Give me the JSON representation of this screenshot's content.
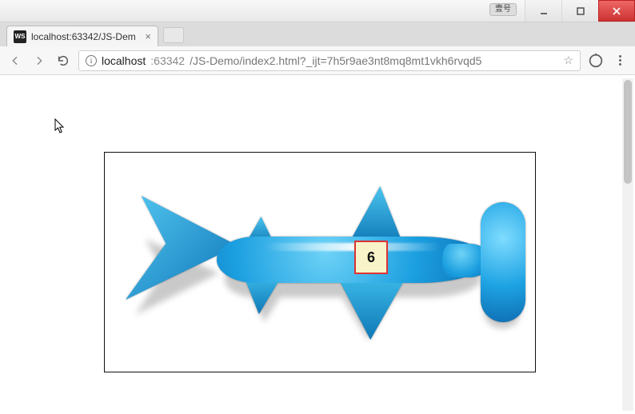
{
  "window": {
    "lang_badge": "壹号"
  },
  "tab": {
    "favicon_text": "WS",
    "title": "localhost:63342/JS-Dem"
  },
  "address": {
    "host": "localhost",
    "port": ":63342",
    "path": "/JS-Demo/index2.html?_ijt=7h5r9ae3nt8mq8mt1vkh6rvqd5"
  },
  "content": {
    "counter": "6"
  }
}
